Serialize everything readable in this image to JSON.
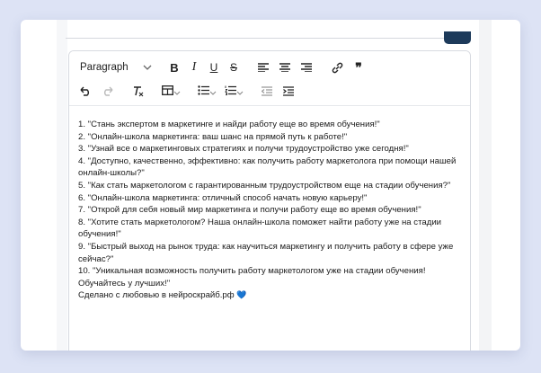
{
  "toolbar": {
    "format_select": "Paragraph",
    "bold": "B",
    "italic": "I",
    "underline": "U",
    "strike": "S",
    "quote": "❞"
  },
  "content": {
    "items": [
      "1. \"Стань экспертом в маркетинге и найди работу еще во время обучения!\"",
      "2. \"Онлайн-школа маркетинга: ваш шанс на прямой путь к работе!\"",
      "3. \"Узнай все о маркетинговых стратегиях и получи трудоустройство уже сегодня!\"",
      "4. \"Доступно, качественно, эффективно: как получить работу маркетолога при помощи нашей онлайн-школы?\"",
      "5. \"Как стать маркетологом с гарантированным трудоустройством еще на стадии обучения?\"",
      "6. \"Онлайн-школа маркетинга: отличный способ начать новую карьеру!\"",
      "7. \"Открой для себя новый мир маркетинга и получи работу еще во время обучения!\"",
      "8. \"Хотите стать маркетологом? Наша онлайн-школа поможет найти работу уже на стадии обучения!\"",
      "9. \"Быстрый выход на рынок труда: как научиться маркетингу и получить работу в сфере уже сейчас?\"",
      "10. \"Уникальная возможность получить работу маркетологом уже на стадии обучения! Обучайтесь у лучших!\""
    ],
    "signature": "Сделано с любовью в нейроскрайб.рф",
    "heart": "💙"
  },
  "colors": {
    "page_bg": "#dde3f5",
    "accent": "#1d3a5a"
  }
}
